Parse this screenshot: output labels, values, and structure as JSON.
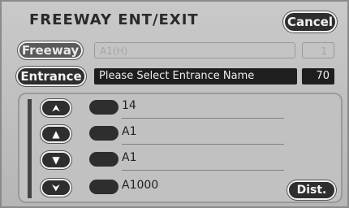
{
  "title": "FREEWAY ENT/EXIT",
  "cancel_label": "Cancel",
  "freeway": {
    "button_label": "Freeway",
    "field_value": "A1(H)",
    "count": "1"
  },
  "entrance": {
    "button_label": "Entrance",
    "field_value": "Please Select Entrance Name",
    "count": "70"
  },
  "scroll": {
    "page_up_icon": "double-chevron-up",
    "up_icon": "chevron-up",
    "down_icon": "chevron-down",
    "page_down_icon": "double-chevron-down"
  },
  "list": {
    "items": [
      {
        "label": "14"
      },
      {
        "label": "A1"
      },
      {
        "label": "A1"
      },
      {
        "label": "A1000"
      }
    ]
  },
  "dist_label": "Dist."
}
